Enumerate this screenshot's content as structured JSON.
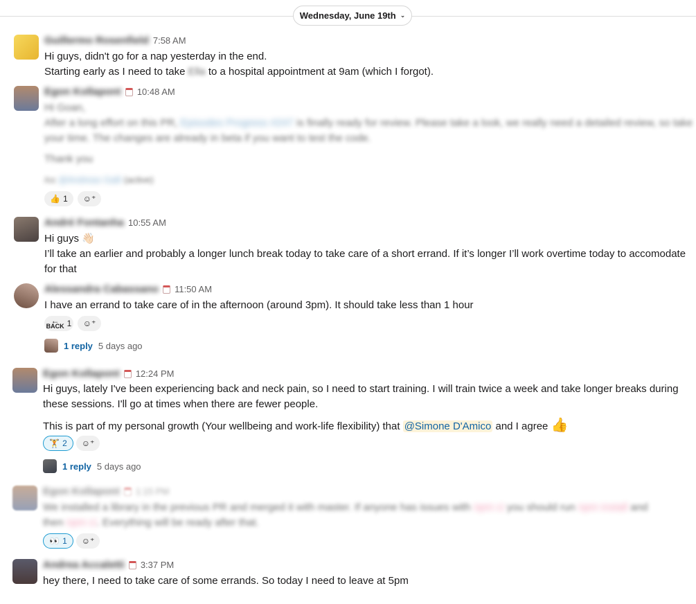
{
  "date_divider": {
    "label": "Wednesday, June 19th",
    "chevron_icon": "chevron-down-icon"
  },
  "messages": [
    {
      "time": "7:58 AM",
      "lines": [
        "Hi guys, didn't go for a nap yesterday in the end.",
        "Starting early as I need to take",
        "to a hospital appointment at 9am (which I forgot)."
      ]
    },
    {
      "time": "10:48 AM",
      "reactions": [
        {
          "emoji": "👍",
          "count": "1"
        }
      ]
    },
    {
      "time": "10:55 AM",
      "lines": [
        "Hi guys",
        "I’ll take an earlier and probably a longer lunch break today to take care of a short errand. If it’s longer I’ll work overtime today to accomodate",
        "for that"
      ],
      "emoji": "👋🏻"
    },
    {
      "time": "11:50 AM",
      "lines": [
        "I have an errand to take care of in the afternoon (around 3pm). It should take less than 1 hour"
      ],
      "reactions": [
        {
          "emoji": "back-arrow-icon",
          "label": "BACK",
          "count": "1"
        }
      ],
      "thread": {
        "replies": "1 reply",
        "ago": "5 days ago"
      }
    },
    {
      "time": "12:24 PM",
      "lines": [
        "Hi guys, lately I've been experiencing back and neck pain, so I need to start training. I will train twice a week and take longer breaks during",
        "these sessions. I'll go at times when there are fewer people.",
        "This is part of my personal growth (Your wellbeing and work-life flexibility) that",
        "and I agree"
      ],
      "mention": "@Simone D'Amico",
      "emoji": "👍",
      "reactions": [
        {
          "emoji": "🏋",
          "count": "2"
        }
      ],
      "thread": {
        "replies": "1 reply",
        "ago": "5 days ago"
      }
    },
    {
      "reactions": [
        {
          "emoji": "👀",
          "count": "1"
        }
      ]
    },
    {
      "time": "3:37 PM",
      "lines": [
        "hey there, I need to take care of some errands. So today I need to leave at 5pm"
      ]
    }
  ],
  "colors": {
    "link": "#1264a3",
    "mention_bg": "#fdf3d9",
    "reaction_active_border": "#1d9bd1",
    "timestamp": "#616061"
  },
  "icons": {
    "add_reaction": "add-reaction-icon",
    "calendar": "calendar-status-icon"
  }
}
